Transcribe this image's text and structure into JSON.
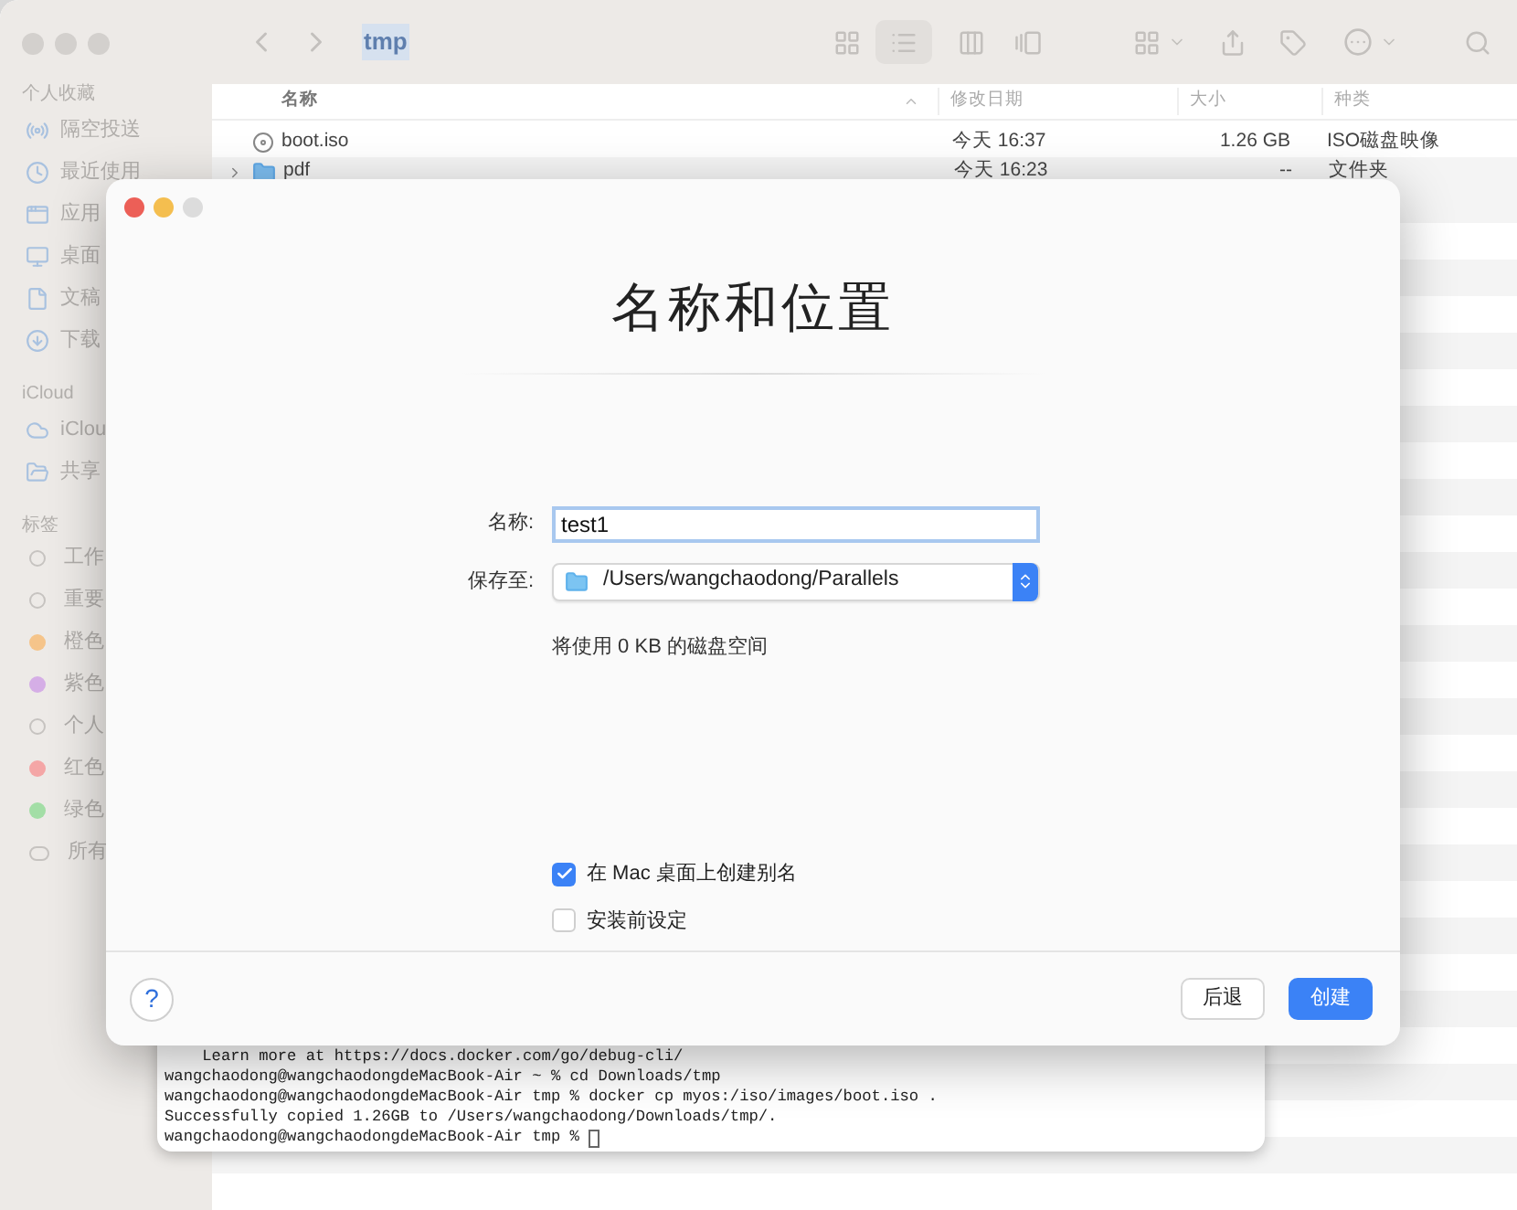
{
  "finder": {
    "title": "tmp",
    "sidebar": [
      {
        "heading": "个人收藏",
        "items": [
          {
            "label": "隔空投送"
          },
          {
            "label": "最近使用"
          },
          {
            "label": "应用"
          },
          {
            "label": "桌面"
          },
          {
            "label": "文稿"
          },
          {
            "label": "下载"
          }
        ]
      },
      {
        "heading": "iCloud",
        "items": [
          {
            "label": "iClou"
          },
          {
            "label": "共享"
          }
        ]
      }
    ],
    "tags": {
      "heading": "标签",
      "items": [
        {
          "label": "工作",
          "kind": "hollow"
        },
        {
          "label": "重要",
          "kind": "hollow"
        },
        {
          "label": "橙色",
          "kind": "dot",
          "color": "#f5c48a"
        },
        {
          "label": "紫色",
          "kind": "dot",
          "color": "#d5aee6"
        },
        {
          "label": "个人",
          "kind": "hollow"
        },
        {
          "label": "红色",
          "kind": "dot",
          "color": "#f4a6a6"
        },
        {
          "label": "绿色",
          "kind": "dot",
          "color": "#a3dea6"
        },
        {
          "label": "所有",
          "kind": "all"
        }
      ]
    },
    "columns": [
      "名称",
      "修改日期",
      "大小",
      "种类"
    ],
    "rows": [
      {
        "kind": "file",
        "name": "boot.iso",
        "date": "今天 16:37",
        "size": "1.26 GB",
        "type": "ISO磁盘映像"
      },
      {
        "kind": "folder",
        "name": "pdf",
        "date": "今天 16:23",
        "size": "--",
        "type": "文件夹"
      }
    ]
  },
  "terminal": {
    "lines": [
      "    Learn more at https://docs.docker.com/go/debug-cli/",
      "wangchaodong@wangchaodongdeMacBook-Air ~ % cd Downloads/tmp",
      "wangchaodong@wangchaodongdeMacBook-Air tmp % docker cp myos:/iso/images/boot.iso .",
      "Successfully copied 1.26GB to /Users/wangchaodong/Downloads/tmp/.",
      "wangchaodong@wangchaodongdeMacBook-Air tmp % "
    ]
  },
  "dialog": {
    "title": "名称和位置",
    "name": {
      "label": "名称:",
      "value": "test1"
    },
    "location": {
      "label": "保存至:",
      "value": "/Users/wangchaodong/Parallels"
    },
    "note": "将使用 0 KB 的磁盘空间",
    "options": [
      {
        "label": "在 Mac 桌面上创建别名",
        "checked": true
      },
      {
        "label": "安装前设定",
        "checked": false
      }
    ],
    "help": "?",
    "buttons": [
      {
        "label": "后退",
        "primary": false
      },
      {
        "label": "创建",
        "primary": true
      }
    ]
  }
}
